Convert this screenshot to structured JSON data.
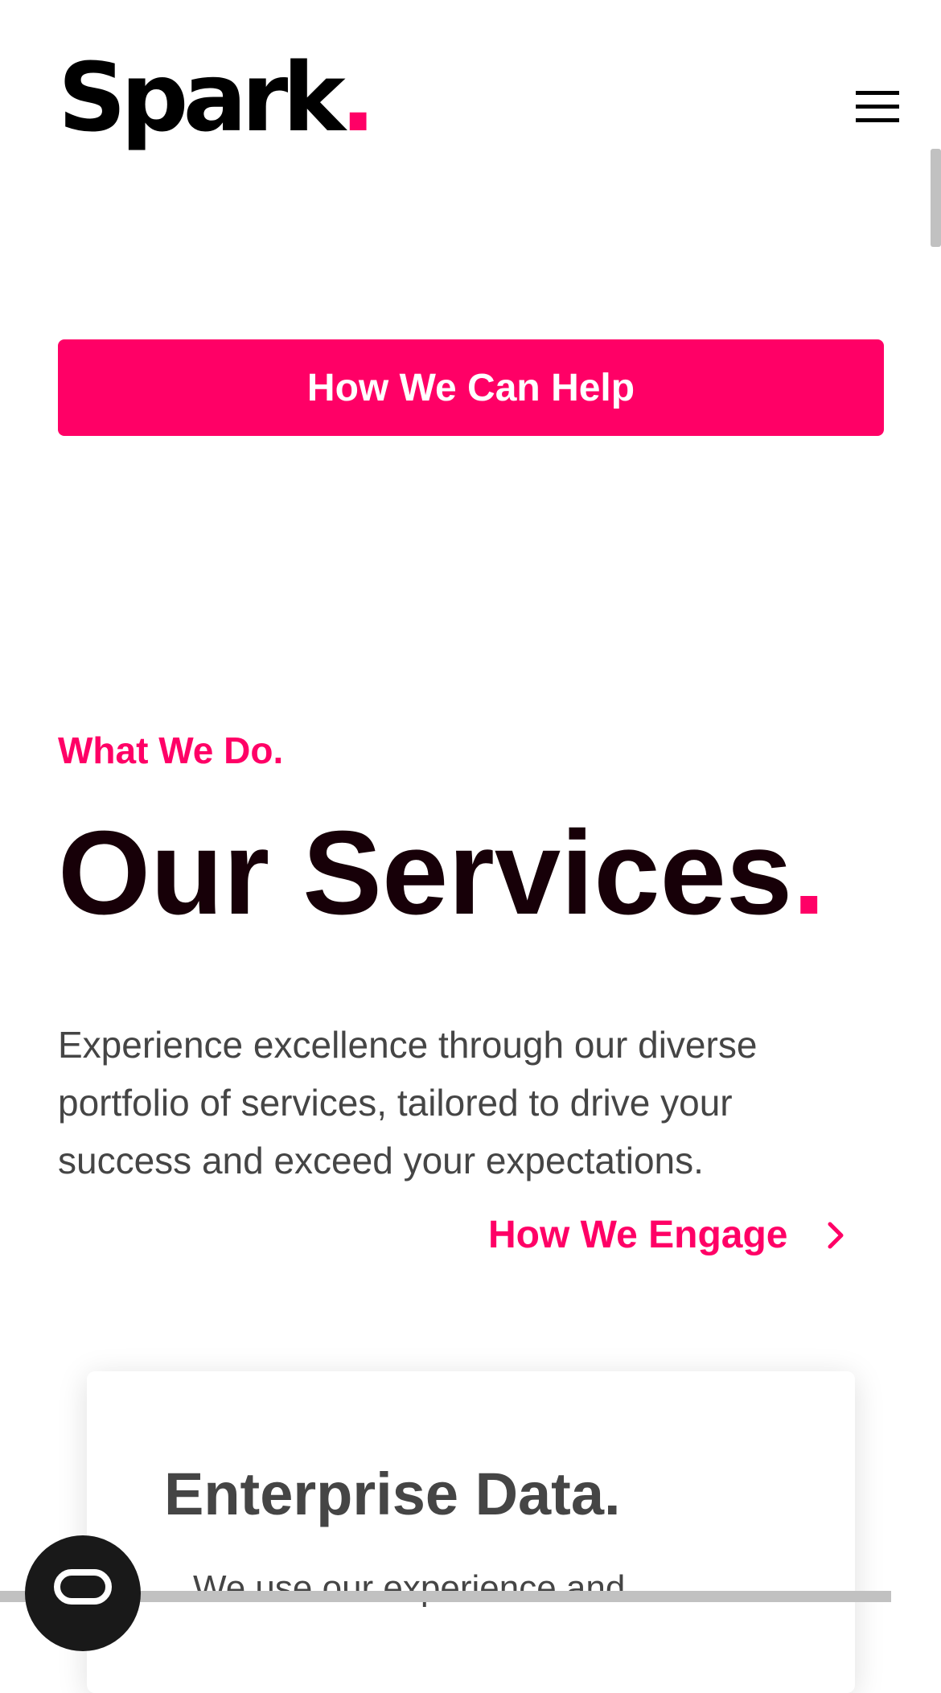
{
  "header": {
    "logo_text": "Spark",
    "logo_dot": ".",
    "menu_icon": "hamburger-menu-icon"
  },
  "cta": {
    "label": "How We Can Help"
  },
  "services": {
    "eyebrow": "What We Do.",
    "title": "Our Services",
    "title_dot": ".",
    "description": "Experience excellence through our diverse portfolio of services, tailored to drive your success and exceed your expectations.",
    "engage_link": "How We Engage",
    "engage_icon": "chevron-right-icon"
  },
  "card": {
    "title": "Enterprise Data.",
    "text": "We use our experience and"
  },
  "chat": {
    "icon": "chat-bubble-icon"
  },
  "colors": {
    "accent": "#ff0066",
    "heading": "#170008",
    "body_text": "#454545"
  }
}
